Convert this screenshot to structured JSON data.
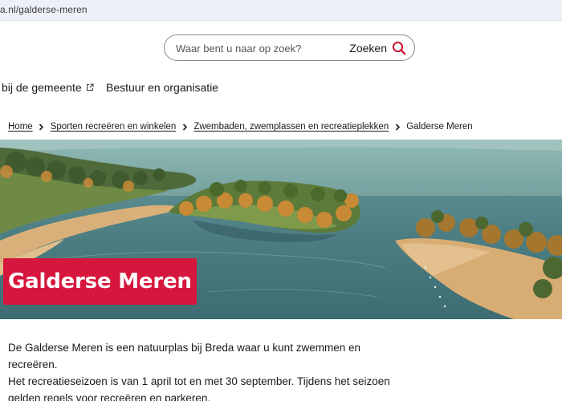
{
  "browser": {
    "url": "a.nl/galderse-meren"
  },
  "search": {
    "placeholder": "Waar bent u naar op zoek?",
    "button_label": "Zoeken",
    "icon": "search-icon"
  },
  "nav": {
    "items": [
      {
        "label": "bij de gemeente",
        "icon": "external-link-icon"
      },
      {
        "label": "Bestuur en organisatie"
      }
    ]
  },
  "breadcrumb": {
    "items": [
      {
        "label": "Home"
      },
      {
        "label": "Sporten recreëren en winkelen"
      },
      {
        "label": "Zwembaden, zwemplassen en recreatieplekken"
      }
    ],
    "current": "Galderse Meren",
    "separator_icon": "chevron-right-icon"
  },
  "hero": {
    "title": "Galderse Meren",
    "image": "aerial-lake-photo",
    "title_bg": "#d6163c"
  },
  "intro": {
    "lines": [
      "De Galderse Meren is een natuurplas bij Breda waar u kunt zwemmen en recreëren.",
      "Het recreatieseizoen is van 1 april tot en met 30 september. Tijdens het seizoen",
      "gelden regels voor recreëren en parkeren."
    ]
  }
}
